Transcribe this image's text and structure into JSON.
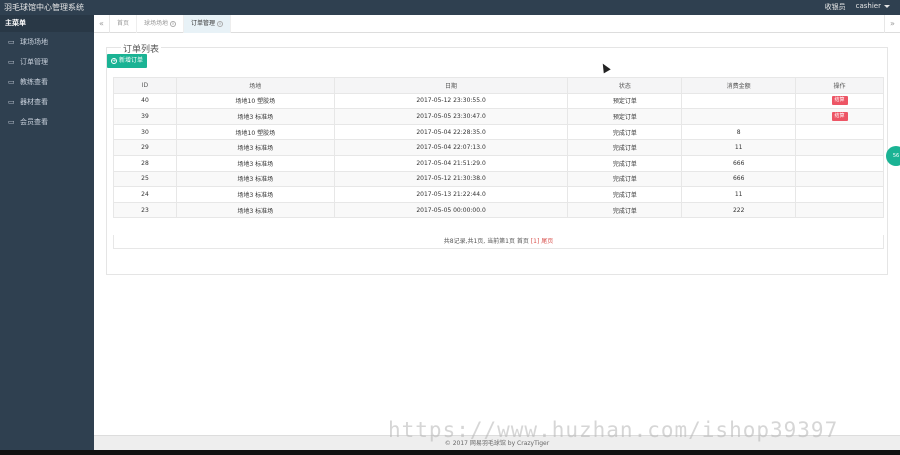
{
  "app": {
    "title": "羽毛球馆中心管理系统",
    "user_role": "收银员",
    "user_name": "cashier"
  },
  "sidebar": {
    "header": "主菜单",
    "items": [
      {
        "label": "球场场地",
        "icon": "folder-icon"
      },
      {
        "label": "订单管理",
        "icon": "folder-icon"
      },
      {
        "label": "教练查看",
        "icon": "folder-icon"
      },
      {
        "label": "器材查看",
        "icon": "folder-icon"
      },
      {
        "label": "会员查看",
        "icon": "folder-icon"
      }
    ]
  },
  "tabs": [
    {
      "label": "首页",
      "closable": false,
      "active": false
    },
    {
      "label": "球场场地",
      "closable": true,
      "active": false
    },
    {
      "label": "订单管理",
      "closable": true,
      "active": true
    }
  ],
  "panel": {
    "title": "订单列表",
    "add_button": "新增订单"
  },
  "table": {
    "headers": [
      "ID",
      "场地",
      "日期",
      "状态",
      "消费金额",
      "操作"
    ],
    "rows": [
      {
        "id": "40",
        "court": "场地10 塑胶场",
        "date": "2017-05-12 23:30:55.0",
        "status": "预定订单",
        "amount": "",
        "action": "结算"
      },
      {
        "id": "39",
        "court": "场地3 标准场",
        "date": "2017-05-05 23:30:47.0",
        "status": "预定订单",
        "amount": "",
        "action": "结算"
      },
      {
        "id": "30",
        "court": "场地10 塑胶场",
        "date": "2017-05-04 22:28:35.0",
        "status": "完成订单",
        "amount": "8",
        "action": ""
      },
      {
        "id": "29",
        "court": "场地3 标准场",
        "date": "2017-05-04 22:07:13.0",
        "status": "完成订单",
        "amount": "11",
        "action": ""
      },
      {
        "id": "28",
        "court": "场地3 标准场",
        "date": "2017-05-04 21:51:29.0",
        "status": "完成订单",
        "amount": "666",
        "action": ""
      },
      {
        "id": "25",
        "court": "场地3 标准场",
        "date": "2017-05-12 21:30:38.0",
        "status": "完成订单",
        "amount": "666",
        "action": ""
      },
      {
        "id": "24",
        "court": "场地3 标准场",
        "date": "2017-05-13 21:22:44.0",
        "status": "完成订单",
        "amount": "11",
        "action": ""
      },
      {
        "id": "23",
        "court": "场地3 标准场",
        "date": "2017-05-05 00:00:00.0",
        "status": "完成订单",
        "amount": "222",
        "action": ""
      }
    ]
  },
  "pager": {
    "text": "共8记录,共1页, 当前第1页 首页",
    "current": "[1]",
    "last": "尾页"
  },
  "float_badge": "56",
  "footer": "© 2017 网易羽毛球馆 by CrazyTiger",
  "watermark": "https://www.huzhan.com/ishop39397",
  "colors": {
    "sidebar_bg": "#2f4050",
    "accent_green": "#1ab394",
    "action_red": "#ed5565"
  }
}
